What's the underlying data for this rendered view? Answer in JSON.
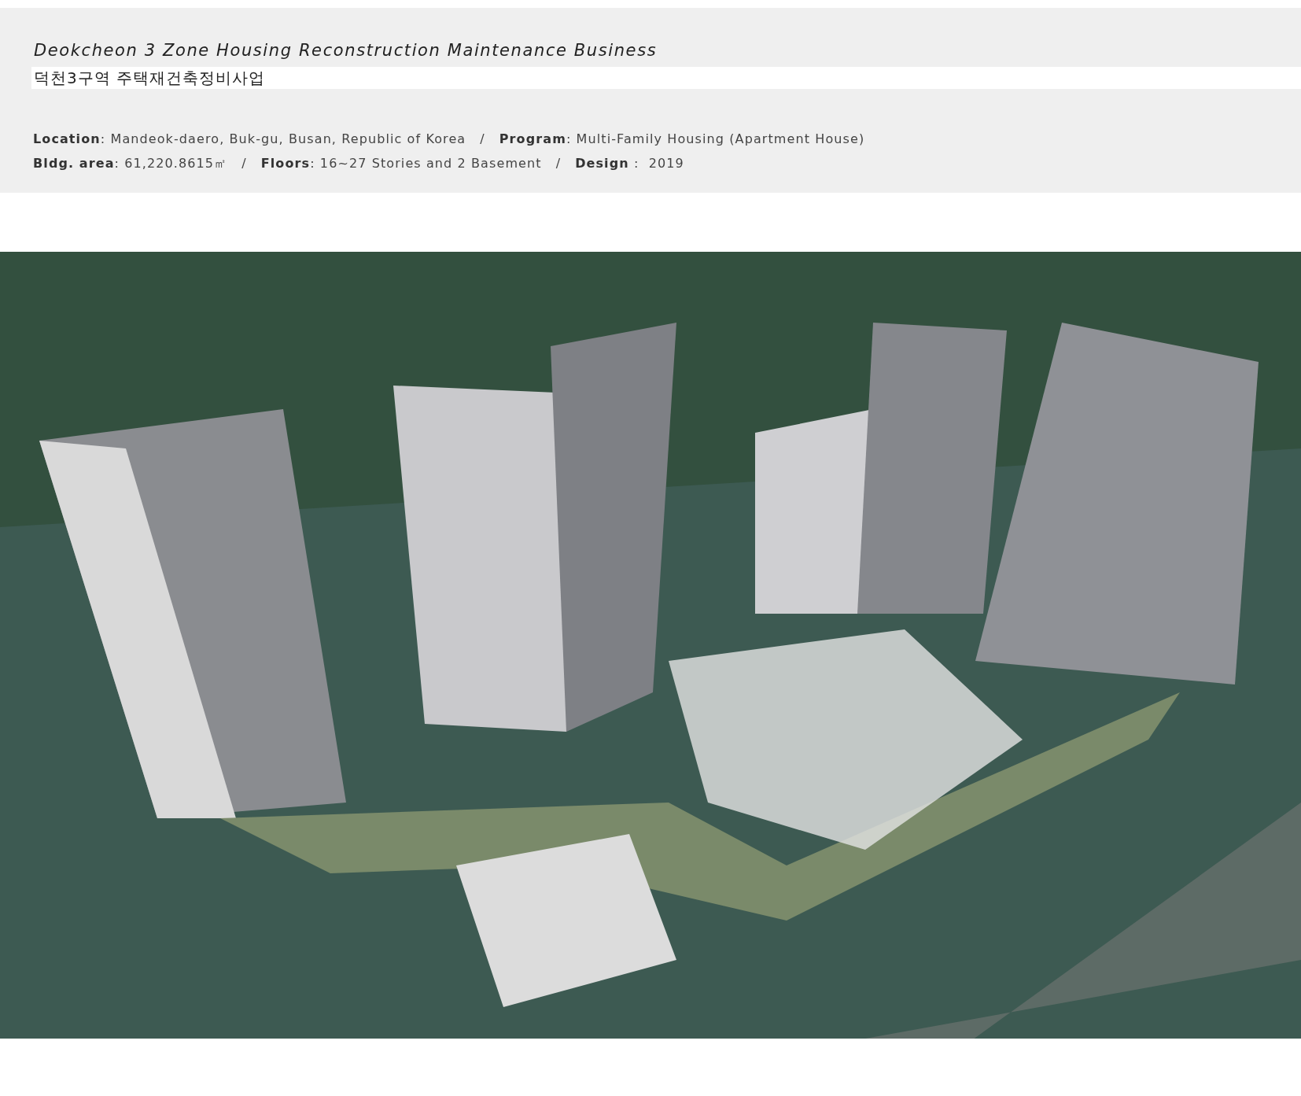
{
  "header": {
    "title": "Deokcheon 3 Zone Housing Reconstruction Maintenance Business",
    "subtitle": "덕천3구역 주택재건축정비사업",
    "info_lines": [
      {
        "divider": "/",
        "items": [
          {
            "label": "Location",
            "value": ": Mandeok-daero, Buk-gu, Busan, Republic of Korea"
          },
          {
            "label": "Program",
            "value": ": Multi-Family Housing (Apartment House)"
          }
        ]
      },
      {
        "divider": "/",
        "items": [
          {
            "label": "Bldg. area",
            "value": ": 61,220.8615㎡"
          },
          {
            "label": "Floors",
            "value": ": 16~27 Stories and 2 Basement"
          },
          {
            "label": "Design",
            "value": " :  2019"
          }
        ]
      }
    ]
  }
}
